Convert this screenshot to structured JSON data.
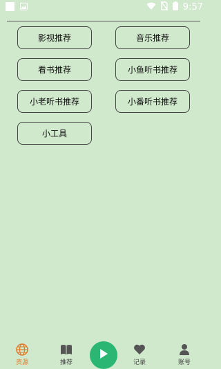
{
  "status_bar": {
    "time": "9:57",
    "icons": [
      "notification-square-icon",
      "image-icon",
      "wifi-icon",
      "no-sim-icon",
      "battery-icon"
    ]
  },
  "menu": {
    "buttons": [
      {
        "label": "影视推荐"
      },
      {
        "label": "音乐推荐"
      },
      {
        "label": "看书推荐"
      },
      {
        "label": "小鱼听书推荐"
      },
      {
        "label": "小老听书推荐"
      },
      {
        "label": "小番听书推荐"
      },
      {
        "label": "小工具"
      }
    ]
  },
  "bottom_nav": {
    "items": [
      {
        "label": "资源",
        "icon": "globe-icon",
        "active": true
      },
      {
        "label": "推荐",
        "icon": "book-icon",
        "active": false
      },
      {
        "label": "",
        "icon": "play-icon",
        "active": false
      },
      {
        "label": "记录",
        "icon": "heart-icon",
        "active": false
      },
      {
        "label": "账号",
        "icon": "user-icon",
        "active": false
      }
    ]
  },
  "colors": {
    "background": "#d0e9cc",
    "active": "#e07a2a",
    "play": "#2bb673",
    "icon": "#555555"
  }
}
